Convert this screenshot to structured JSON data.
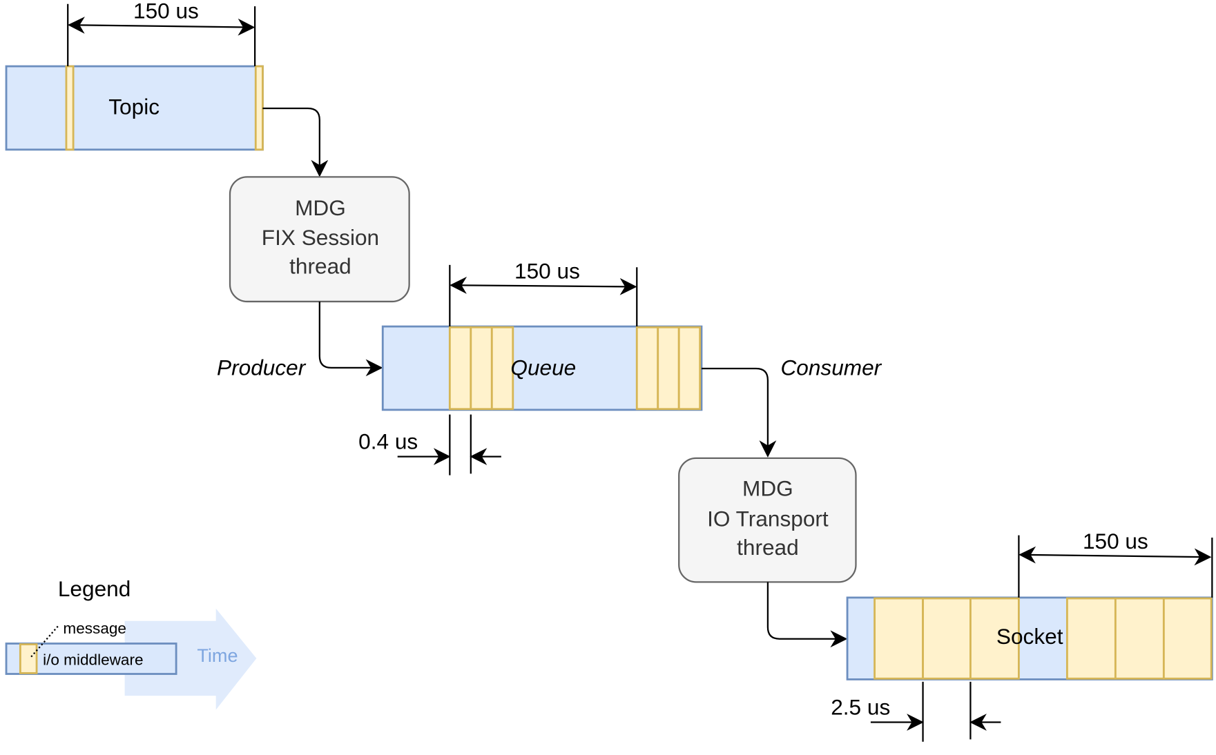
{
  "colors": {
    "buffer_fill": "#dae8fc",
    "buffer_stroke": "#6c8ebf",
    "message_fill": "#fff2cc",
    "message_stroke": "#d6b656",
    "thread_fill": "#f5f5f5",
    "thread_stroke": "#666666",
    "time_arrow": "#dae8fc",
    "time_text": "#7ea6e0"
  },
  "topic": {
    "label": "Topic",
    "dimension": "150 us"
  },
  "fix_thread": {
    "lines": [
      "MDG",
      "FIX Session",
      "thread"
    ]
  },
  "producer_label": "Producer",
  "queue": {
    "label": "Queue",
    "dimension": "150 us",
    "message_dimension": "0.4 us"
  },
  "consumer_label": "Consumer",
  "io_thread": {
    "lines": [
      "MDG",
      "IO Transport",
      "thread"
    ]
  },
  "socket": {
    "label": "Socket",
    "dimension": "150 us",
    "message_dimension": "2.5 us"
  },
  "legend": {
    "title": "Legend",
    "message": "message",
    "io_middleware": "i/o middleware",
    "time": "Time"
  }
}
